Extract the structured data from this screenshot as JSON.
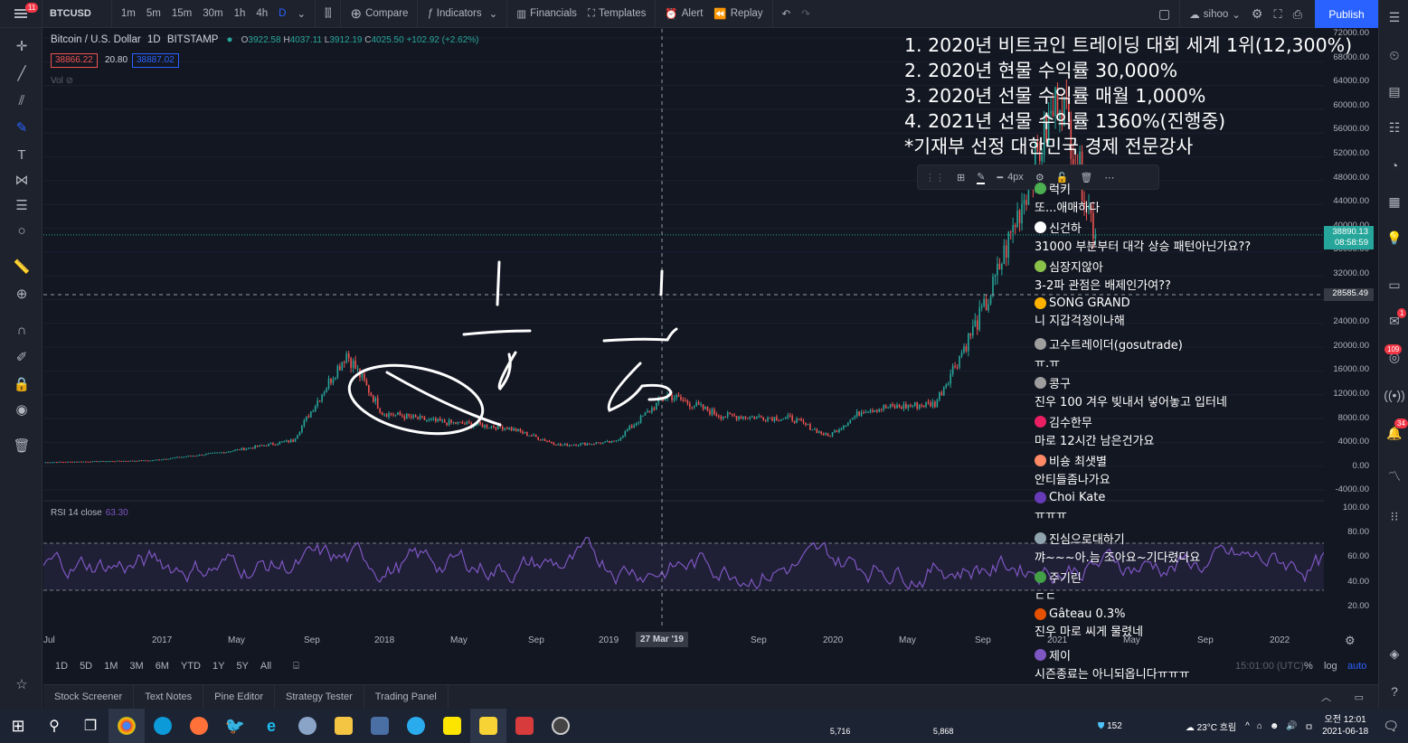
{
  "topbar": {
    "menu_badge": "11",
    "symbol": "BTCUSD",
    "intervals": [
      "1m",
      "5m",
      "15m",
      "30m",
      "1h",
      "4h",
      "D"
    ],
    "active_interval": "D",
    "compare": "Compare",
    "indicators": "Indicators",
    "financials": "Financials",
    "templates": "Templates",
    "alert": "Alert",
    "replay": "Replay",
    "layout_name": "sihoo",
    "publish": "Publish"
  },
  "legend": {
    "title": "Bitcoin / U.S. Dollar",
    "interval": "1D",
    "exchange": "BITSTAMP",
    "o_label": "O",
    "o": "3922.58",
    "h_label": "H",
    "h": "4037.11",
    "l_label": "L",
    "l": "3912.19",
    "c_label": "C",
    "c": "4025.50",
    "change": "+102.92 (+2.62%)",
    "sell_price": "38866.22",
    "spread": "20.80",
    "buy_price": "38887.02",
    "vol_label": "Vol",
    "rsi_label": "RSI 14 close",
    "rsi_value": "63.30"
  },
  "price_axis": {
    "labels": [
      "72000.00",
      "68000.00",
      "64000.00",
      "60000.00",
      "56000.00",
      "52000.00",
      "48000.00",
      "44000.00",
      "40000.00",
      "36000.00",
      "32000.00",
      "28000.00",
      "24000.00",
      "20000.00",
      "16000.00",
      "12000.00",
      "8000.00",
      "4000.00",
      "0.00",
      "-4000.00"
    ],
    "current_price": "38890.13",
    "countdown": "08:58:59",
    "crosshair_price": "28585.49",
    "rsi_labels": [
      "100.00",
      "80.00",
      "60.00",
      "40.00",
      "20.00"
    ]
  },
  "time_axis": {
    "labels": [
      "Jul",
      "2017",
      "May",
      "Sep",
      "2018",
      "May",
      "Sep",
      "2019",
      "Sep",
      "2020",
      "May",
      "Sep",
      "2021",
      "May",
      "Sep",
      "2022"
    ],
    "crosshair_date": "27 Mar '19"
  },
  "range_bar": {
    "ranges": [
      "1D",
      "5D",
      "1M",
      "3M",
      "6M",
      "YTD",
      "1Y",
      "5Y",
      "All"
    ],
    "time": "15:01:00 (UTC)",
    "percent": "%",
    "log": "log",
    "auto": "auto"
  },
  "bottom_panel": {
    "tabs": [
      "Stock Screener",
      "Text Notes",
      "Pine Editor",
      "Strategy Tester",
      "Trading Panel"
    ]
  },
  "promo": {
    "lines": [
      "1. 2020년 비트코인 트레이딩 대회 세계 1위(12,300%)",
      "2. 2020년 현물 수익률 30,000%",
      "3. 2020년 선물 수익률 매월 1,000%",
      "4. 2021년 선물 수익률 1360%(진행중)",
      "*기재부 선정 대한민국 경제 전문강사"
    ]
  },
  "floating_toolbar": {
    "width_label": "4px"
  },
  "chat": [
    {
      "nick": "럭키",
      "text": "또...애매하다",
      "color": "#4caf50"
    },
    {
      "nick": "신건하",
      "text": "31000 부분부터 대각 상승 패턴아닌가요??",
      "color": "#ffffff"
    },
    {
      "nick": "심장지않아",
      "text": "3-2파 관점은 배제인가여??",
      "color": "#8bc34a"
    },
    {
      "nick": "SONG GRAND",
      "text": "니 지갑걱정이나해",
      "color": "#ffb300"
    },
    {
      "nick": "고수트레이더(gosutrade)",
      "text": "ㅠ.ㅠ",
      "color": "#9e9e9e"
    },
    {
      "nick": "콩구",
      "text": "진우 100 겨우 빚내서 넣어놓고 입터네",
      "color": "#9e9e9e"
    },
    {
      "nick": "김수한무",
      "text": "마로 12시간 남은건가요",
      "color": "#e91e63"
    },
    {
      "nick": "비숑 최샛별",
      "text": "안티들좀나가요",
      "color": "#ff8a65"
    },
    {
      "nick": "Choi Kate",
      "text": "ㅠㅠㅠ",
      "color": "#673ab7"
    },
    {
      "nick": "진심으로대하기",
      "text": "꺄~~~아.늠 조아요~기다렸다요",
      "color": "#90a4ae"
    },
    {
      "nick": "주기린",
      "text": "ㄷㄷ",
      "color": "#43a047"
    },
    {
      "nick": "Gâteau 0.3%",
      "text": "진우 마로 씨게 물렸네",
      "color": "#e65100"
    },
    {
      "nick": "제이",
      "text": "시즌종료는 아니되옵니다ㅠㅠㅠ",
      "color": "#7e57c2"
    }
  ],
  "taskbar": {
    "weather": "23°C 흐림",
    "time": "오전 12:01",
    "date": "2021-06-18",
    "tray_count_left": "152",
    "tray_count_a": "5,716",
    "tray_count_b": "5,868"
  },
  "right_badges": [
    "1",
    "109",
    "34"
  ],
  "colors": {
    "background": "#131722",
    "panel": "#1e222d",
    "accent": "#2962ff",
    "up": "#26a69a",
    "down": "#ef5350",
    "rsi": "#7e57c2"
  },
  "chart_data": {
    "type": "candlestick",
    "symbol": "BTCUSD",
    "ylim": [
      -4000,
      72000
    ],
    "approx_close_path": [
      {
        "x": "Jul 2016",
        "y": 650
      },
      {
        "x": "Jan 2017",
        "y": 950
      },
      {
        "x": "May 2017",
        "y": 2300
      },
      {
        "x": "Sep 2017",
        "y": 4300
      },
      {
        "x": "Dec 2017",
        "y": 19000
      },
      {
        "x": "Feb 2018",
        "y": 9000
      },
      {
        "x": "May 2018",
        "y": 7500
      },
      {
        "x": "Sep 2018",
        "y": 6500
      },
      {
        "x": "Dec 2018",
        "y": 3500
      },
      {
        "x": "Mar 2019",
        "y": 4025
      },
      {
        "x": "Jun 2019",
        "y": 12000
      },
      {
        "x": "Sep 2019",
        "y": 8500
      },
      {
        "x": "Jan 2020",
        "y": 8000
      },
      {
        "x": "Mar 2020",
        "y": 5000
      },
      {
        "x": "May 2020",
        "y": 9500
      },
      {
        "x": "Sep 2020",
        "y": 10500
      },
      {
        "x": "Dec 2020",
        "y": 28000
      },
      {
        "x": "Apr 2021",
        "y": 63000
      },
      {
        "x": "Jun 2021",
        "y": 38890
      }
    ],
    "rsi": {
      "period": 14,
      "upper_band": 70,
      "lower_band": 30,
      "current": 63.3
    }
  }
}
